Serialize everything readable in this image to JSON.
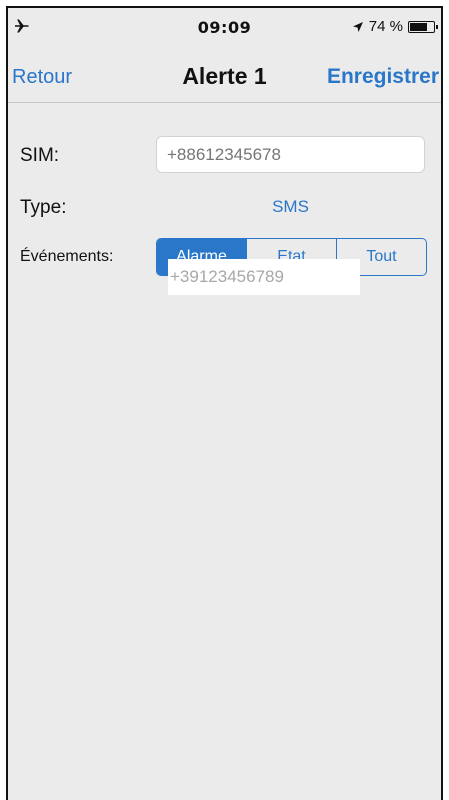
{
  "status_bar": {
    "time": "09:09",
    "battery_text": "74 %",
    "battery_level": 0.74,
    "airplane_icon": "airplane-icon",
    "location_icon": "location-arrow-icon"
  },
  "nav": {
    "back_label": "Retour",
    "title": "Alerte 1",
    "save_label": "Enregistrer"
  },
  "form": {
    "sim_label": "SIM:",
    "sim_placeholder": "+88612345678",
    "type_label": "Type:",
    "type_value": "SMS",
    "events_label": "Événements:",
    "events_options": [
      "Alarme",
      "Etat",
      "Tout"
    ],
    "events_selected": "Alarme",
    "overlay_value": "+39123456789"
  },
  "colors": {
    "accent": "#2a77c9",
    "background": "#ebebeb"
  }
}
